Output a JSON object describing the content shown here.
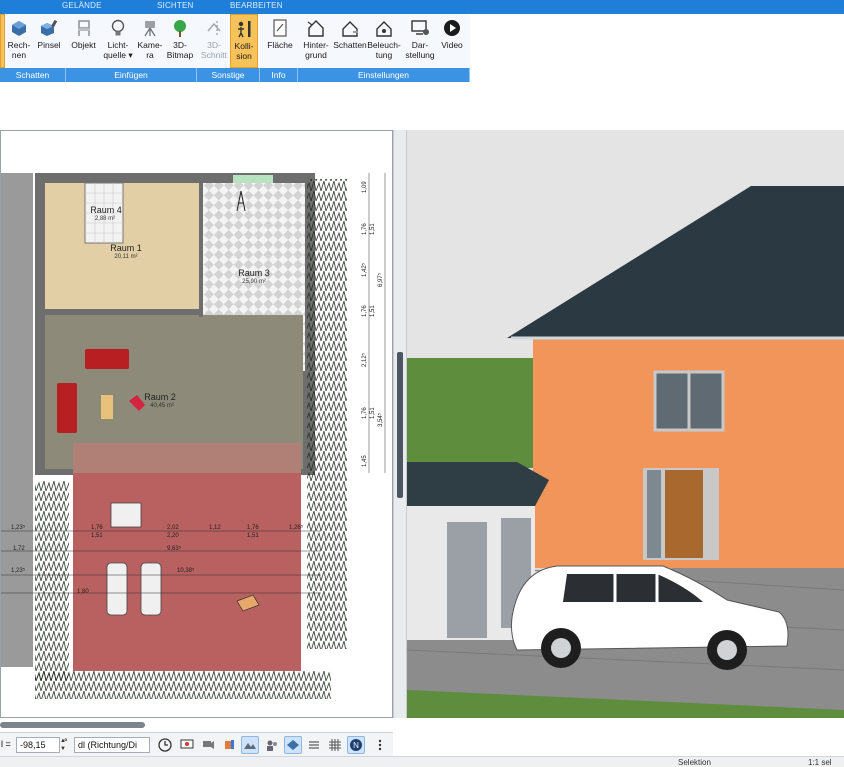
{
  "ribbon": {
    "tabs": [
      "GELÄNDE",
      "SICHTEN",
      "BEARBEITEN"
    ],
    "buttons": {
      "rechnen": "Rech-\nnen",
      "pinsel": "Pinsel",
      "objekt": "Objekt",
      "lichtquelle": "Licht-\nquelle ▾",
      "kamera": "Kame-\nra",
      "bitmap3d": "3D-\nBitmap",
      "schnitt3d": "3D-\nSchnitt",
      "kollision": "Kolli-\nsion",
      "flaeche": "Fläche",
      "hintergrund": "Hinter-\ngrund",
      "schatten": "Schatten",
      "beleuchtung": "Beleuch-\ntung",
      "darstellung": "Dar-\nstellung",
      "video": "Video"
    },
    "groups": {
      "schatten": "Schatten",
      "einfuegen": "Einfügen",
      "sonstige": "Sonstige",
      "info": "Info",
      "einstellungen": "Einstellungen"
    }
  },
  "plan": {
    "rooms": [
      {
        "name": "Raum 4",
        "area": "2,88 m²"
      },
      {
        "name": "Raum 1",
        "area": "20,11 m²"
      },
      {
        "name": "Raum 3",
        "area": "25,90 m²"
      },
      {
        "name": "Raum 2",
        "area": "40,45 m²"
      }
    ],
    "dims_h": [
      "1,23⁵",
      "1,76",
      "1,51",
      "2,02",
      "2,20",
      "1,12",
      "1,76",
      "1,51",
      "1,26⁵",
      "1,72",
      "9,63⁵",
      "1,23⁵",
      "10,38⁵",
      "1,80"
    ],
    "dims_v": [
      "1,09",
      "1,76",
      "1,51",
      "1,42⁵",
      "6,97⁵",
      "1,76",
      "1,51",
      "2,12⁵",
      "1,76",
      "1,51",
      "3,54⁵",
      "1,45"
    ]
  },
  "toolbar": {
    "angle_value": "-98,15",
    "angle_unit": "°",
    "mode_select": "dl (Richtung/Di",
    "left_cut": "l ="
  },
  "status": {
    "mode": "Selektion",
    "scale": "1:1 sel"
  },
  "colors": {
    "ribbon_blue": "#1f7fd8",
    "group_blue": "#3d93e3",
    "active_orange": "#f6c25a",
    "house_wall": "#f2955a",
    "roof": "#2b3a42",
    "terrace": "#b96060"
  }
}
